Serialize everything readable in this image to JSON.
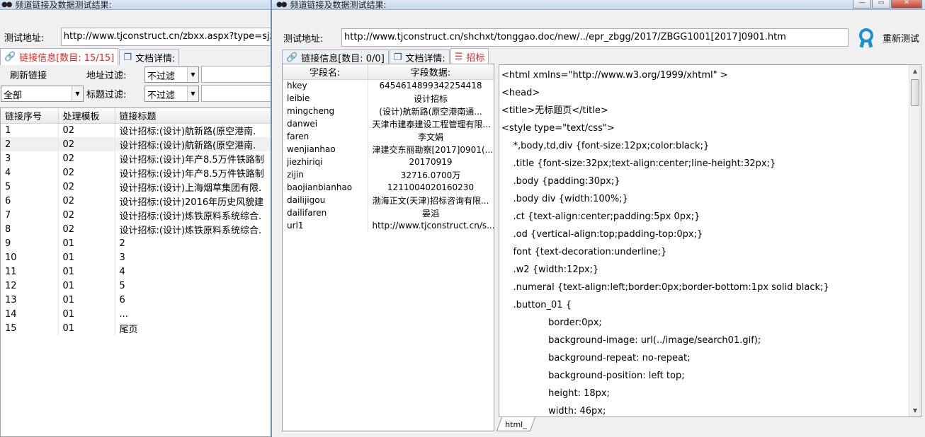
{
  "left_window": {
    "title": "频道链接及数据测试结果:",
    "address_label": "测试地址:",
    "address_value": "http://www.tjconstruct.cn/zbxx.aspx?type=sjzb",
    "tabs": [
      {
        "label": "链接信息[数目: 15/15]",
        "icon": "link-icon"
      },
      {
        "label": "文档详情:",
        "icon": "document-icon"
      }
    ],
    "refresh_label": "刷新链接",
    "address_filter_label": "地址过滤:",
    "address_filter_value": "不过滤",
    "title_filter_label": "标题过滤:",
    "title_filter_value": "不过滤",
    "scope_value": "全部",
    "columns": [
      "链接序号",
      "处理模板",
      "链接标题"
    ],
    "rows": [
      [
        "1",
        "02",
        "设计招标:(设计)航新路(原空港南."
      ],
      [
        "2",
        "02",
        "设计招标:(设计)航新路(原空港南."
      ],
      [
        "3",
        "02",
        "设计招标:(设计)年产8.5万件铁路制"
      ],
      [
        "4",
        "02",
        "设计招标:(设计)年产8.5万件铁路制"
      ],
      [
        "5",
        "02",
        "设计招标:(设计)上海烟草集团有限."
      ],
      [
        "6",
        "02",
        "设计招标:(设计)2016年历史风貌建"
      ],
      [
        "7",
        "02",
        "设计招标:(设计)炼铁原料系统综合."
      ],
      [
        "8",
        "02",
        "设计招标:(设计)炼铁原料系统综合."
      ],
      [
        "9",
        "01",
        "2"
      ],
      [
        "10",
        "01",
        "3"
      ],
      [
        "11",
        "01",
        "4"
      ],
      [
        "12",
        "01",
        "5"
      ],
      [
        "13",
        "01",
        "6"
      ],
      [
        "14",
        "01",
        "..."
      ],
      [
        "15",
        "01",
        "尾页"
      ]
    ]
  },
  "right_window": {
    "title": "频道链接及数据测试结果:",
    "address_label": "测试地址:",
    "address_value": "http://www.tjconstruct.cn/shchxt/tonggao.doc/new/../epr_zbgg/2017/ZBGG1001[2017]0901.htm",
    "retest_label": "重新测试",
    "tabs": [
      {
        "label": "链接信息[数目: 0/0]",
        "icon": "link-icon"
      },
      {
        "label": "文档详情:",
        "icon": "document-icon"
      },
      {
        "label": "招标",
        "icon": "database-icon"
      }
    ],
    "field_columns": [
      "字段名:",
      "字段数据:"
    ],
    "fields": [
      [
        "hkey",
        "6454614899342254418"
      ],
      [
        "leibie",
        "设计招标"
      ],
      [
        "mingcheng",
        "(设计)航新路(原空港南通..."
      ],
      [
        "danwei",
        "天津市建泰建设工程管理有限..."
      ],
      [
        "faren",
        "李文娟"
      ],
      [
        "wenjianhao",
        "津建交东丽勘察[2017]0901(..."
      ],
      [
        "jiezhiriqi",
        "20170919"
      ],
      [
        "zijin",
        "32716.0700万"
      ],
      [
        "baojianbianhao",
        "1211004020160230"
      ],
      [
        "dailijigou",
        "渤海正文(天津)招标咨询有限..."
      ],
      [
        "dailifaren",
        "晏滔"
      ],
      [
        "url1",
        "http://www.tjconstruct.cn/s..."
      ]
    ],
    "html_lines": [
      "<html xmlns=\"http://www.w3.org/1999/xhtml\" >",
      "<head>",
      "<title>无标题页</title>",
      "<style type=\"text/css\">",
      "    *,body,td,div {font-size:12px;color:black;}",
      "    .title {font-size:32px;text-align:center;line-height:32px;}",
      "    .body {padding:30px;}",
      "    .body div {width:100%;}",
      "    .ct {text-align:center;padding:5px 0px;}",
      "    .od {vertical-align:top;padding-top:0px;}",
      "    font {text-decoration:underline;}",
      "    .w2 {width:12px;}",
      "    .numeral {text-align:left;border:0px;border-bottom:1px solid black;}",
      "    .button_01 {",
      "                border:0px;",
      "                background-image: url(../image/search01.gif);",
      "                background-repeat: no-repeat;",
      "                background-position: left top;",
      "                height: 18px;",
      "                width: 46px;"
    ],
    "bottom_tab": "html_"
  }
}
